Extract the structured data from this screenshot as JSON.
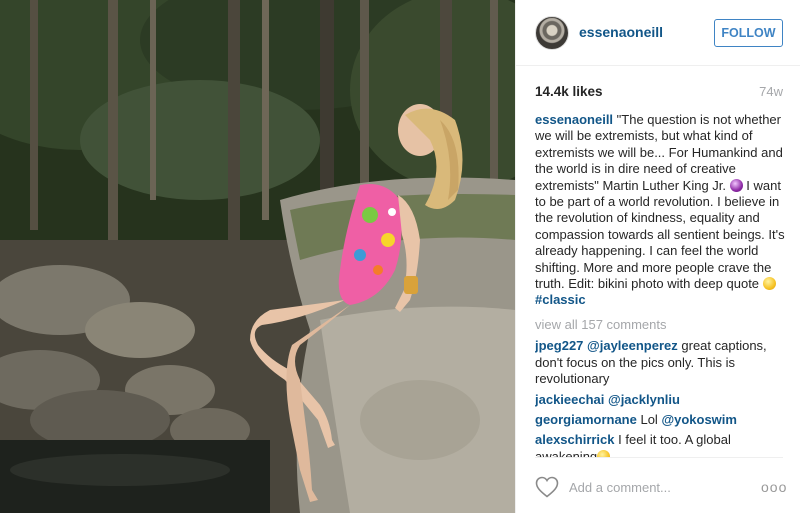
{
  "post": {
    "author": "essenaoneill",
    "follow_label": "FOLLOW",
    "likes": "14.4k likes",
    "age": "74w"
  },
  "caption": {
    "author": "essenaoneill",
    "text_1": " \"The question is not whether we will be extremists, but what kind of extremists we will be... For Humankind and the world is in dire need of creative extremists\" Martin Luther King Jr. ",
    "text_2": " I want to be part of a world revolution. I believe in the revolution of kindness, equality and compassion towards all sentient beings. It's already happening. I can feel the world shifting. More and more people crave the truth. Edit: bikini photo with deep quote ",
    "hashtag": "#classic"
  },
  "view_all": "view all 157 comments",
  "comments": [
    {
      "author": "jpeg227",
      "mention": "@jayleenperez",
      "text": " great captions, don't focus on the pics only. This is revolutionary"
    },
    {
      "author": "jackieechai",
      "mention": "@jacklynliu",
      "text": ""
    },
    {
      "author": "georgiamornane",
      "mention": "",
      "text": " Lol ",
      "mention2": "@yokoswim"
    },
    {
      "author": "alexschirrick",
      "mention": "",
      "text": " I feel it too. A global awakening"
    }
  ],
  "footer": {
    "placeholder": "Add a comment...",
    "more": "ooo"
  },
  "icons": {
    "heart": "heart-outline-icon",
    "more": "more-options-icon",
    "emoji_purple": "purple-face-emoji",
    "emoji_yellow": "smiling-face-emoji"
  },
  "colors": {
    "link": "#125688",
    "follow": "#3f84c4",
    "muted": "#a5a7aa"
  }
}
